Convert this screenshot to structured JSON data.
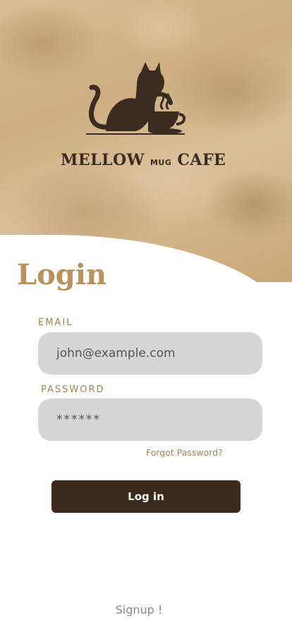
{
  "brand": {
    "name_left": "MELLOW",
    "name_mid": "MUG",
    "name_right": "CAFE",
    "logo_icon": "cat-with-coffee-cup-icon"
  },
  "login": {
    "title": "Login",
    "email_label": "EMAIL",
    "email_value": "john@example.com",
    "password_label": "PASSWORD",
    "password_value": "******",
    "forgot_label": "Forgot Password?",
    "submit_label": "Log in",
    "signup_label": "Signup !"
  },
  "colors": {
    "accent": "#b8915c",
    "button": "#3c2a1c",
    "field_bg": "#d6d6d6"
  }
}
